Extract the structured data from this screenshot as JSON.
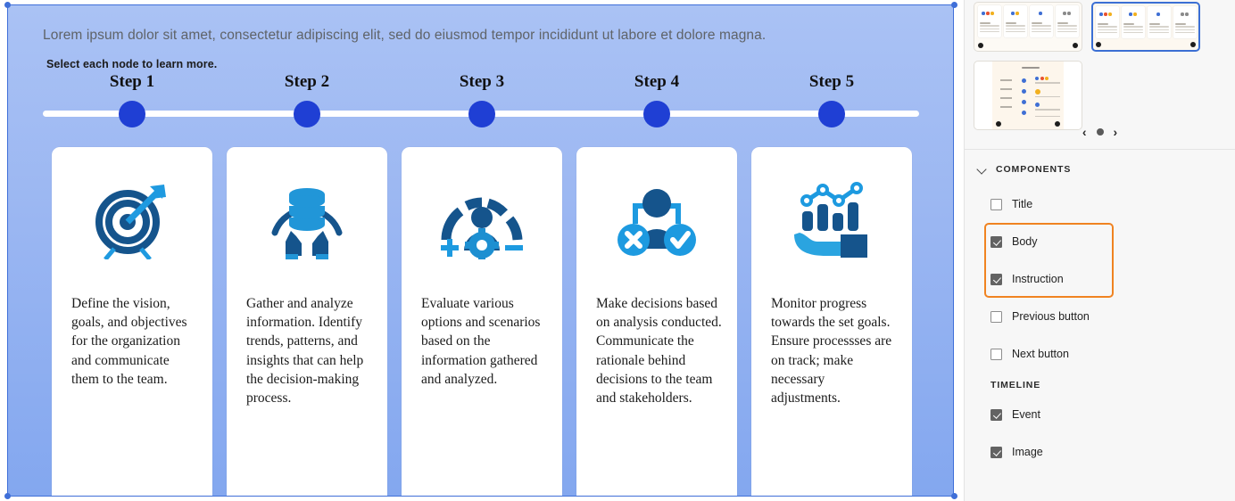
{
  "slide": {
    "body_text": "Lorem ipsum dolor sit amet, consectetur adipiscing elit, sed do eiusmod tempor incididunt ut labore et dolore magna.",
    "instruction_text": "Select each node to learn more.",
    "background_color": "#9ab6f2",
    "node_color": "#1f3fd4",
    "line_color": "#ffffff",
    "steps": [
      {
        "label": "Step 1",
        "icon": "target-arrow-icon",
        "text": "Define the vision, goals, and objectives for the organization and communicate them to the team."
      },
      {
        "label": "Step 2",
        "icon": "database-in-hands-icon",
        "text": "Gather and analyze information. Identify trends, patterns, and insights that can help the decision-making process."
      },
      {
        "label": "Step 3",
        "icon": "person-gauge-gear-icon",
        "text": "Evaluate various options and scenarios based on the information gathered and analyzed."
      },
      {
        "label": "Step 4",
        "icon": "person-approve-reject-icon",
        "text": "Make decisions based on analysis conducted. Communicate the rationale behind decisions to the team and stakeholders."
      },
      {
        "label": "Step 5",
        "icon": "hand-bar-chart-icon",
        "text": "Monitor progress towards the set goals. Ensure processses are on track; make necessary adjustments."
      }
    ]
  },
  "panel": {
    "carousel": {
      "prev_label": "‹",
      "next_label": "›"
    },
    "components_section": {
      "title": "Components",
      "items": [
        {
          "label": "Title",
          "checked": false
        },
        {
          "label": "Body",
          "checked": true
        },
        {
          "label": "Instruction",
          "checked": true
        },
        {
          "label": "Previous button",
          "checked": false
        },
        {
          "label": "Next button",
          "checked": false
        }
      ]
    },
    "timeline_section": {
      "title": "Timeline",
      "items": [
        {
          "label": "Event",
          "checked": true
        },
        {
          "label": "Image",
          "checked": true
        }
      ]
    },
    "highlight_color": "#f08321"
  }
}
